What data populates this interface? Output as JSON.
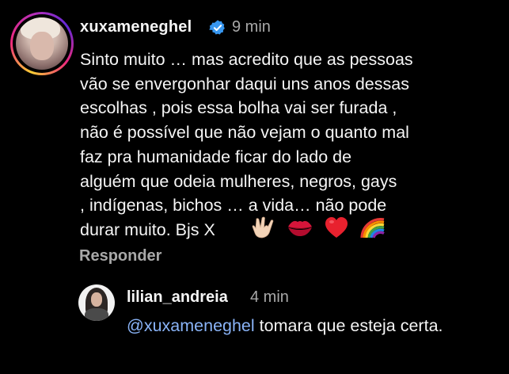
{
  "comment": {
    "username": "xuxameneghel",
    "time": "9 min",
    "text": "Sinto muito … mas acredito que as pessoas\nvão se envergonhar daqui uns anos dessas\nescolhas , pois essa bolha vai ser furada ,\nnão é possível que não vejam o quanto mal\nfaz pra humanidade ficar do lado de\nalguém que odeia mulheres, negros, gays\n, indígenas, bichos … a vida… não pode\ndurar muito. Bjs X",
    "emojis": [
      "love-you-gesture-icon",
      "lips-icon",
      "red-heart-icon",
      "rainbow-icon"
    ],
    "reply_label": "Responder"
  },
  "reply": {
    "username": "lilian_andreia",
    "time": "4 min",
    "mention": "@xuxameneghel",
    "text": " tomara que esteja certa."
  },
  "colors": {
    "background": "#000000",
    "text": "#f5f5f5",
    "muted": "#a8a8a8",
    "mention": "#8ab4f8",
    "verified": "#3897f0"
  }
}
